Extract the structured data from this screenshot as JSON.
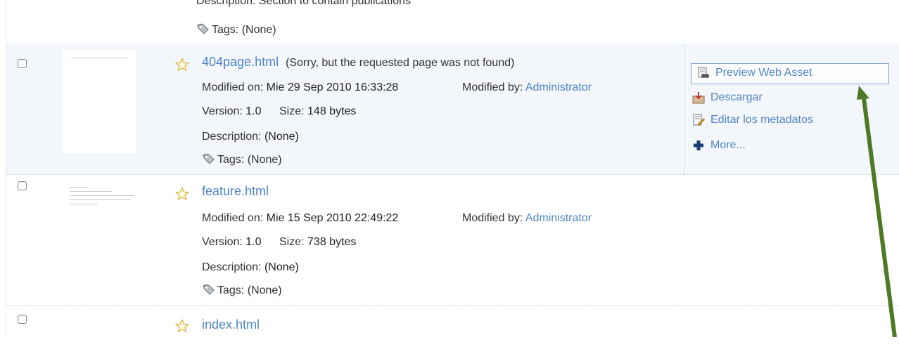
{
  "top_partial": {
    "description": "Description: Section to contain publications",
    "tags": "Tags: (None)"
  },
  "rows": [
    {
      "name": "404page.html",
      "subtitle": "(Sorry, but the requested page was not found)",
      "modified_on_label": "Modified on:",
      "modified_on": "Mie 29 Sep 2010 16:33:28",
      "modified_by_label": "Modified by:",
      "modified_by": "Administrator",
      "version_label": "Version:",
      "version": "1.0",
      "size_label": "Size:",
      "size": "148 bytes",
      "description_label": "Description:",
      "description": "(None)",
      "tags": "Tags: (None)"
    },
    {
      "name": "feature.html",
      "modified_on_label": "Modified on:",
      "modified_on": "Mie 15 Sep 2010 22:49:22",
      "modified_by_label": "Modified by:",
      "modified_by": "Administrator",
      "version_label": "Version:",
      "version": "1.0",
      "size_label": "Size:",
      "size": "738 bytes",
      "description_label": "Description:",
      "description": "(None)",
      "tags": "Tags: (None)"
    },
    {
      "name": "index.html"
    }
  ],
  "actions": {
    "preview": "Preview Web Asset",
    "download": "Descargar",
    "edit_metadata": "Editar los metadatos",
    "more": "More..."
  },
  "colors": {
    "link": "#4f84c4",
    "selected_row_bg": "#f3f7fb",
    "arrow": "#4e7a25"
  },
  "icons": [
    "checkbox",
    "star-icon",
    "tag-icon",
    "preview-icon",
    "download-icon",
    "edit-metadata-icon",
    "plus-icon"
  ]
}
